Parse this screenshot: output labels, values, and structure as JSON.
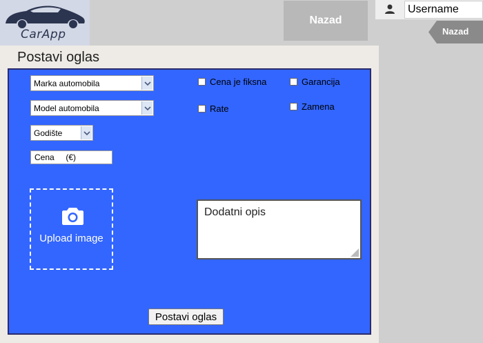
{
  "header": {
    "logo_text": "CarApp",
    "back_button_label": "Nazad",
    "username_value": "Username",
    "back_tag_label": "Nazad"
  },
  "form": {
    "title": "Postavi oglas",
    "brand_select": "Marka automobila",
    "model_select": "Model automobila",
    "year_select": "Godište",
    "price_field": "Cena     (€)",
    "checkboxes": {
      "fixed_price": "Cena je fiksna",
      "warranty": "Garancija",
      "installments": "Rate",
      "exchange": "Zamena"
    },
    "upload_label": "Upload image",
    "description_placeholder": "Dodatni opis",
    "submit_label": "Postavi oglas"
  },
  "colors": {
    "form_background": "#3366ff",
    "page_background": "#cfcfcf",
    "panel_background": "#eeebe6"
  }
}
